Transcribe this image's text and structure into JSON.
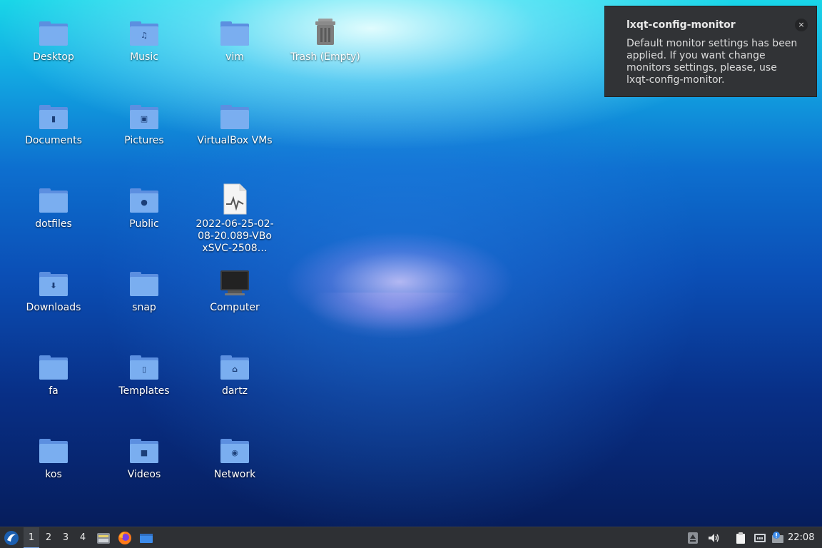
{
  "desktop": {
    "icons": [
      {
        "label": "Desktop",
        "icon": "folder-icon"
      },
      {
        "label": "Music",
        "icon": "music-folder-icon"
      },
      {
        "label": "vim",
        "icon": "folder-icon"
      },
      {
        "label": "Trash (Empty)",
        "icon": "trash-icon"
      },
      {
        "label": "Documents",
        "icon": "documents-folder-icon"
      },
      {
        "label": "Pictures",
        "icon": "pictures-folder-icon"
      },
      {
        "label": "VirtualBox VMs",
        "icon": "folder-icon"
      },
      {
        "label": "dotfiles",
        "icon": "folder-icon"
      },
      {
        "label": "Public",
        "icon": "public-folder-icon"
      },
      {
        "label": "2022-06-25-02-08-20.089-VBoxSVC-2508…",
        "icon": "log-file-icon"
      },
      {
        "label": "Downloads",
        "icon": "downloads-folder-icon"
      },
      {
        "label": "snap",
        "icon": "folder-icon"
      },
      {
        "label": "Computer",
        "icon": "computer-icon"
      },
      {
        "label": "fa",
        "icon": "folder-icon"
      },
      {
        "label": "Templates",
        "icon": "templates-folder-icon"
      },
      {
        "label": "dartz",
        "icon": "home-folder-icon"
      },
      {
        "label": "kos",
        "icon": "folder-icon"
      },
      {
        "label": "Videos",
        "icon": "videos-folder-icon"
      },
      {
        "label": "Network",
        "icon": "network-icon"
      }
    ]
  },
  "notification": {
    "title": "lxqt-config-monitor",
    "body": "Default monitor settings has been applied. If you want change monitors settings, please, use lxqt-config-monitor.",
    "close": "×"
  },
  "taskbar": {
    "menu_icon": "lubuntu-menu-icon",
    "desktops": [
      "1",
      "2",
      "3",
      "4"
    ],
    "active_desktop": "1",
    "launchers": [
      "file-manager-icon",
      "firefox-icon",
      "show-desktop-icon"
    ],
    "tray": [
      "update-notifier-icon",
      "volume-icon",
      "clipboard-icon",
      "network-status-icon",
      "alert-icon"
    ],
    "clock": "22:08"
  },
  "colors": {
    "folder": "#7aaef0",
    "panel": "#2e3034",
    "notification_bg": "#313336"
  }
}
